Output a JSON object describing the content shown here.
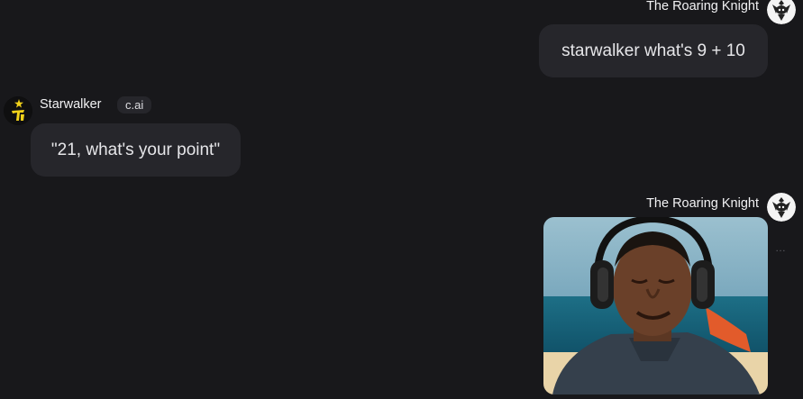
{
  "messages": [
    {
      "sender": "The Roaring Knight",
      "avatar_icon": "roaring-knight-avatar-icon",
      "text": "starwalker what's 9 + 10"
    },
    {
      "sender": "Starwalker",
      "badge": "c.ai",
      "avatar_icon": "starwalker-avatar-icon",
      "text": "\"21, what's your point\""
    },
    {
      "sender": "The Roaring Knight",
      "avatar_icon": "roaring-knight-avatar-icon",
      "image_description": "photo of smiling man wearing headphones"
    }
  ],
  "colors": {
    "background": "#18181b",
    "bubble": "#26262b",
    "text": "#e6e6e9",
    "starwalker_yellow": "#f2d21a"
  }
}
